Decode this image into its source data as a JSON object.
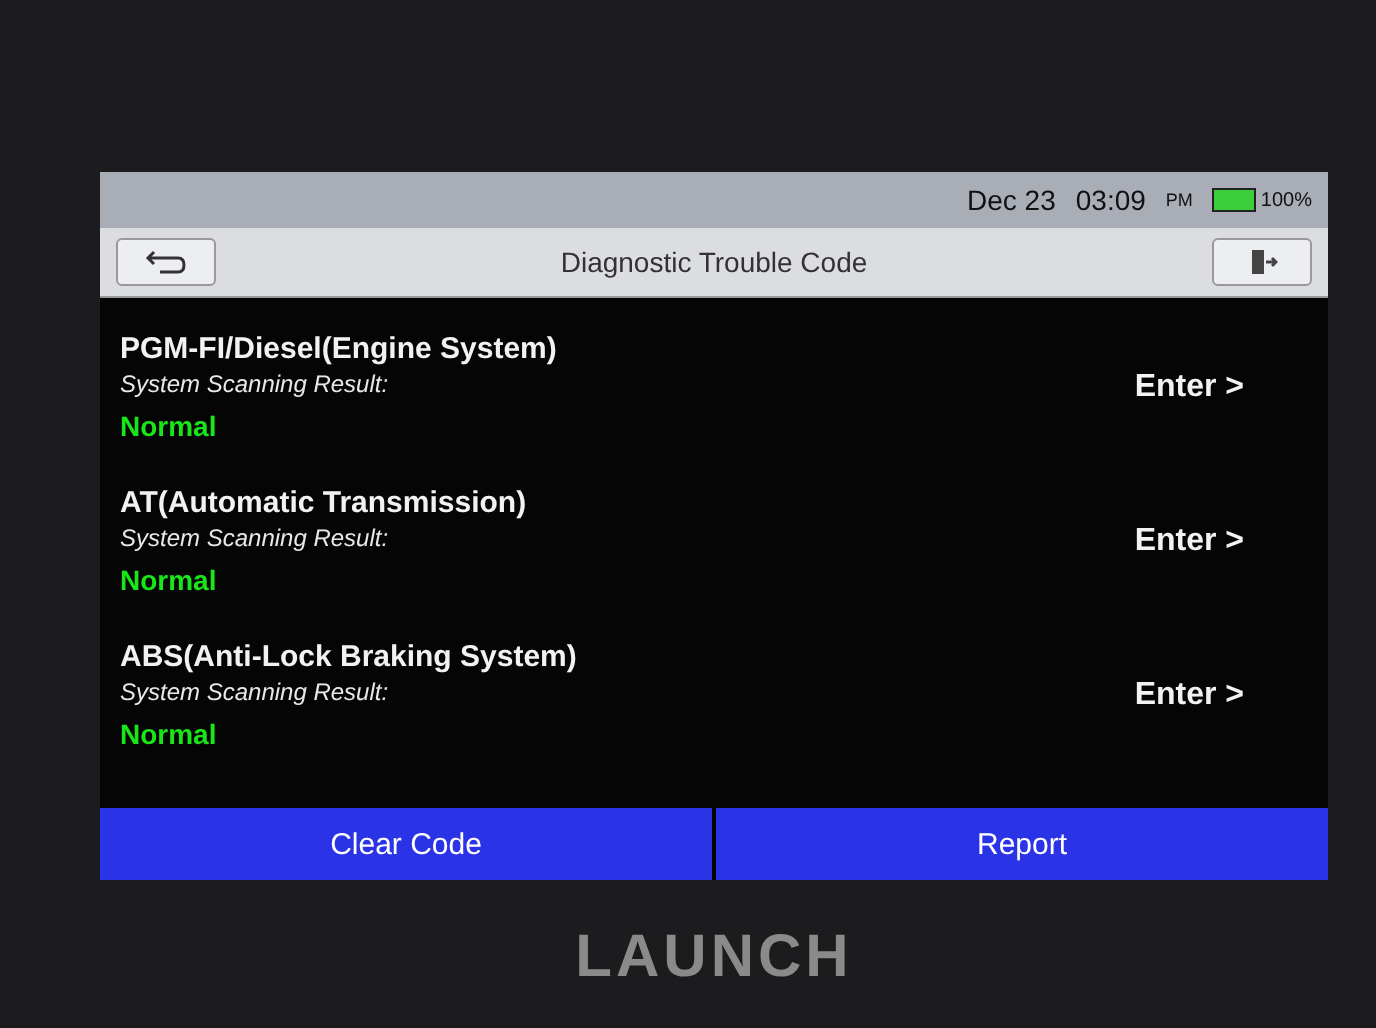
{
  "status_bar": {
    "date": "Dec 23",
    "time": "03:09",
    "meridiem": "PM",
    "battery": "100%"
  },
  "title_bar": {
    "title": "Diagnostic Trouble Code"
  },
  "systems": [
    {
      "name": "PGM-FI/Diesel(Engine System)",
      "label": "System Scanning Result:",
      "result": "Normal",
      "action": "Enter >"
    },
    {
      "name": "AT(Automatic Transmission)",
      "label": "System Scanning Result:",
      "result": "Normal",
      "action": "Enter >"
    },
    {
      "name": "ABS(Anti-Lock Braking System)",
      "label": "System Scanning Result:",
      "result": "Normal",
      "action": "Enter >"
    }
  ],
  "buttons": [
    "Clear Code",
    "Report"
  ],
  "brand": "LAUNCH"
}
